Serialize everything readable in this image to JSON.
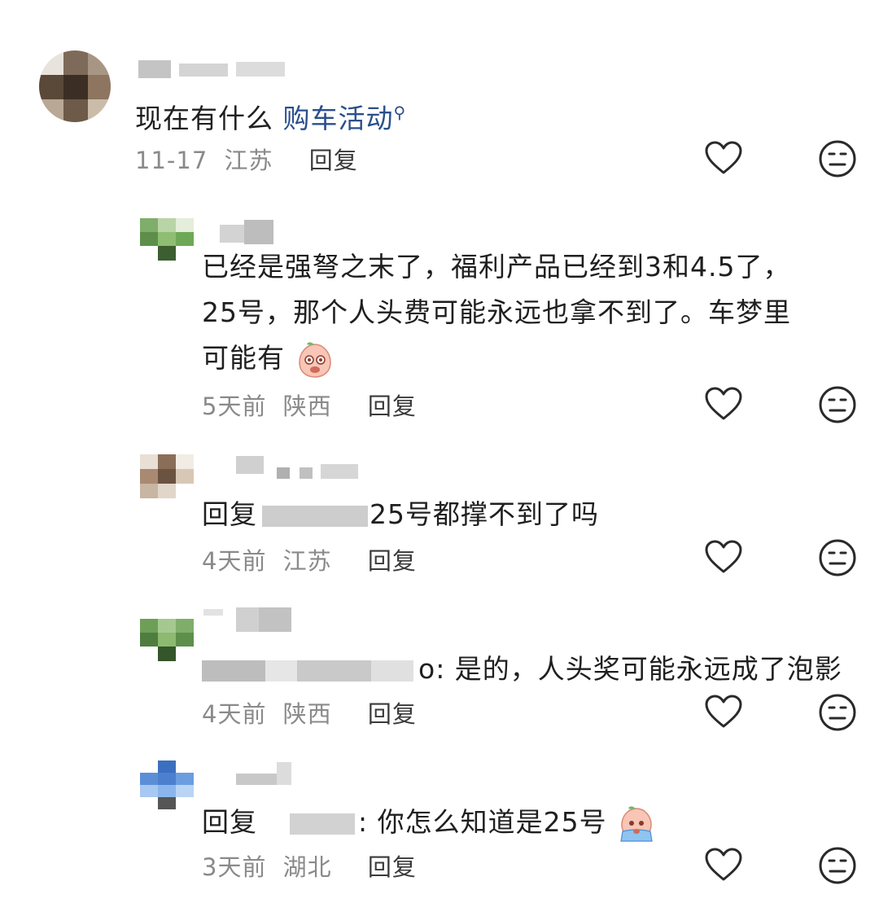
{
  "comments": [
    {
      "text_plain": "现在有什么 ",
      "text_link": "购车活动",
      "date": "11-17",
      "location": "江苏",
      "reply_label": "回复"
    },
    {
      "line1": "已经是强弩之末了，福利产品已经到3和4.5了，",
      "line2": "25号，那个人头费可能永远也拿不到了。车梦里",
      "line3": "可能有",
      "date": "5天前",
      "location": "陕西",
      "reply_label": "回复"
    },
    {
      "prefix": "回复",
      "text": "25号都撑不到了吗",
      "date": "4天前",
      "location": "江苏",
      "reply_label": "回复"
    },
    {
      "text": "o: 是的，人头奖可能永远成了泡影",
      "date": "4天前",
      "location": "陕西",
      "reply_label": "回复"
    },
    {
      "prefix": "回复",
      "text": ": 你怎么知道是25号",
      "date": "3天前",
      "location": "湖北",
      "reply_label": "回复"
    }
  ],
  "icons": {
    "like": "heart-outline-icon",
    "dislike": "neutral-face-icon"
  },
  "colors": {
    "link": "#2b4f8c",
    "meta": "#8a8a8a",
    "text": "#1f1f1f"
  }
}
